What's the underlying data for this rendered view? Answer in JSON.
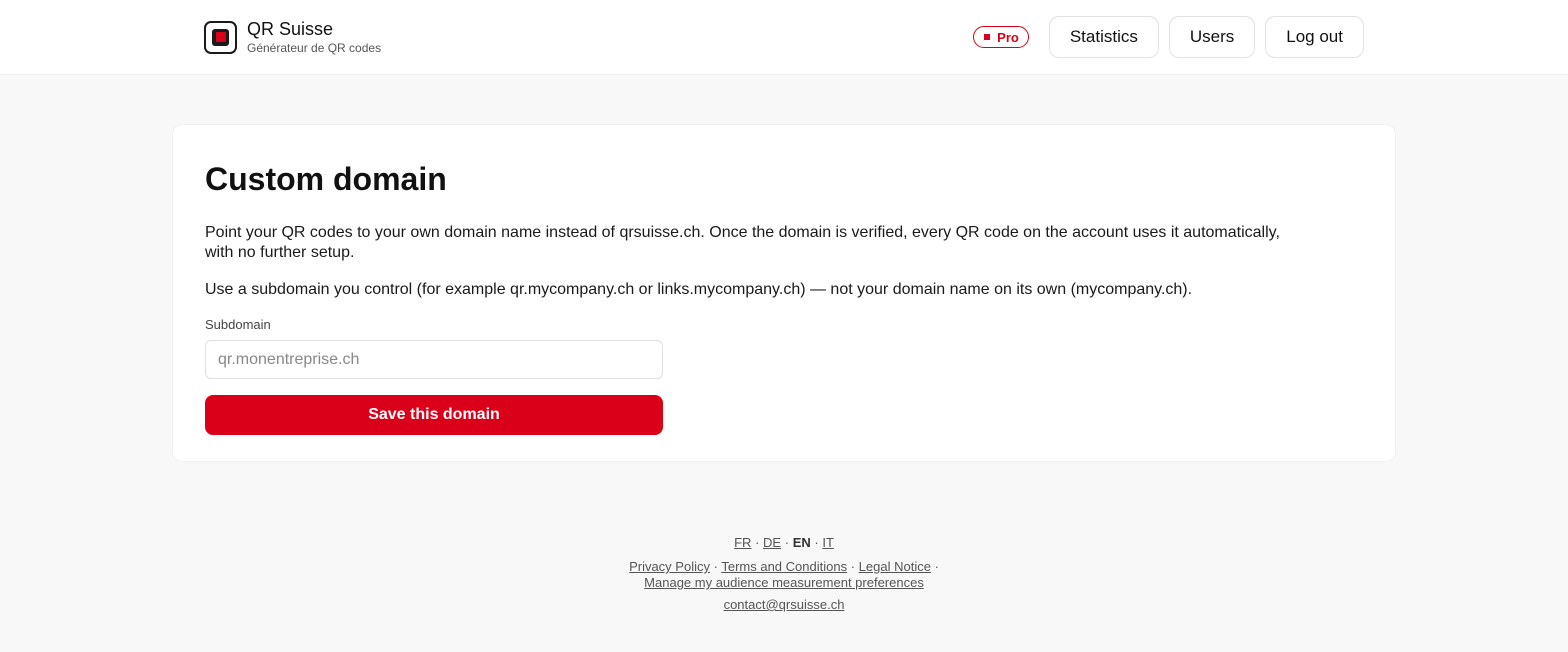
{
  "header": {
    "brand_title": "QR Suisse",
    "brand_subtitle": "Générateur de QR codes",
    "pro_badge": "Pro",
    "nav": {
      "statistics": "Statistics",
      "users": "Users",
      "logout": "Log out"
    }
  },
  "card": {
    "title": "Custom domain",
    "paragraph_1": "Point your QR codes to your own domain name instead of qrsuisse.ch. Once the domain is verified, every QR code on the account uses it automatically, with no further setup.",
    "paragraph_2": "Use a subdomain you control (for example qr.mycompany.ch or links.mycompany.ch) — not your domain name on its own (mycompany.ch).",
    "field_label": "Subdomain",
    "input_value": "",
    "input_placeholder": "qr.monentreprise.ch",
    "save_label": "Save this domain"
  },
  "footer": {
    "languages": {
      "fr": "FR",
      "de": "DE",
      "en": "EN",
      "it": "IT",
      "separator": "·"
    },
    "links": {
      "privacy": "Privacy Policy",
      "terms": "Terms and Conditions",
      "legal": "Legal Notice",
      "audience": "Manage my audience measurement preferences",
      "separator": "·"
    },
    "contact_email": "contact@qrsuisse.ch"
  },
  "colors": {
    "accent": "#da001a",
    "background": "#f8f8f8",
    "card": "#ffffff",
    "text": "#1a1a1a"
  },
  "icons": {
    "logo": "qr-square-logo-icon",
    "pro": "red-square-icon"
  }
}
